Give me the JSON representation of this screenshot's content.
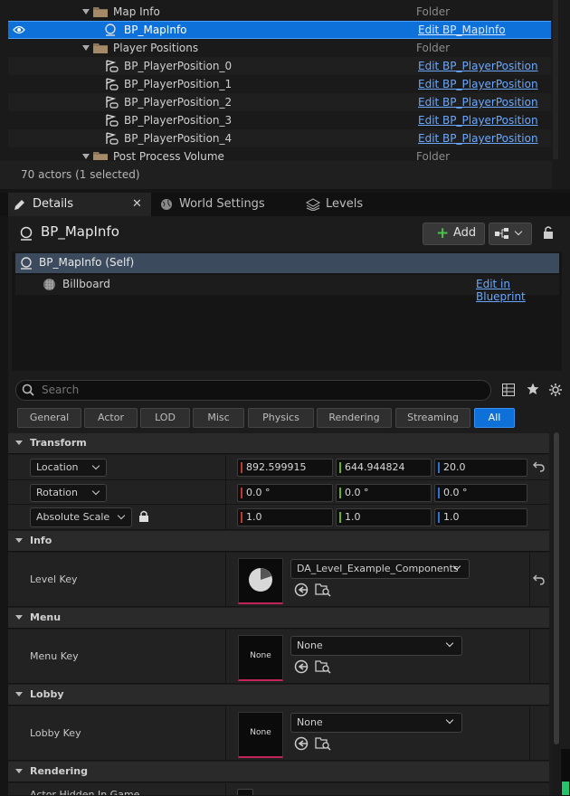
{
  "outliner": {
    "rows": [
      {
        "label": "Map Info",
        "type": "Folder"
      },
      {
        "label": "BP_MapInfo",
        "link": "Edit BP_MapInfo"
      },
      {
        "label": "Player Positions",
        "type": "Folder"
      },
      {
        "label": "BP_PlayerPosition_0",
        "link": "Edit BP_PlayerPosition"
      },
      {
        "label": "BP_PlayerPosition_1",
        "link": "Edit BP_PlayerPosition"
      },
      {
        "label": "BP_PlayerPosition_2",
        "link": "Edit BP_PlayerPosition"
      },
      {
        "label": "BP_PlayerPosition_3",
        "link": "Edit BP_PlayerPosition"
      },
      {
        "label": "BP_PlayerPosition_4",
        "link": "Edit BP_PlayerPosition"
      },
      {
        "label": "Post Process Volume",
        "type": "Folder"
      }
    ],
    "status": "70 actors (1 selected)"
  },
  "tabs": {
    "details": "Details",
    "world_settings": "World Settings",
    "levels": "Levels"
  },
  "details": {
    "title": "BP_MapInfo",
    "add_label": "Add",
    "components": {
      "self": "BP_MapInfo (Self)",
      "billboard": "Billboard",
      "edit_blueprint": "Edit in Blueprint"
    },
    "search_placeholder": "Search",
    "filters": [
      "General",
      "Actor",
      "LOD",
      "Misc",
      "Physics",
      "Rendering",
      "Streaming",
      "All"
    ],
    "sections": {
      "transform": "Transform",
      "info": "Info",
      "menu": "Menu",
      "lobby": "Lobby",
      "rendering": "Rendering"
    },
    "transform": {
      "location": {
        "label": "Location",
        "x": "892.599915",
        "y": "644.944824",
        "z": "20.0"
      },
      "rotation": {
        "label": "Rotation",
        "x": "0.0 °",
        "y": "0.0 °",
        "z": "0.0 °"
      },
      "scale": {
        "label": "Absolute Scale",
        "x": "1.0",
        "y": "1.0",
        "z": "1.0"
      }
    },
    "info": {
      "label": "Level Key",
      "value": "DA_Level_Example_Components"
    },
    "menu": {
      "label": "Menu Key",
      "value": "None",
      "thumb": "None"
    },
    "lobby": {
      "label": "Lobby Key",
      "value": "None",
      "thumb": "None"
    },
    "rendering": {
      "label": "Actor Hidden In Game"
    }
  },
  "colors": {
    "selection": "#0e71d9",
    "link": "#6aa8ff",
    "axis_x": "#c0392b",
    "axis_y": "#6ab023",
    "axis_z": "#2f6fd6",
    "asset_underline": "#c0245a"
  }
}
